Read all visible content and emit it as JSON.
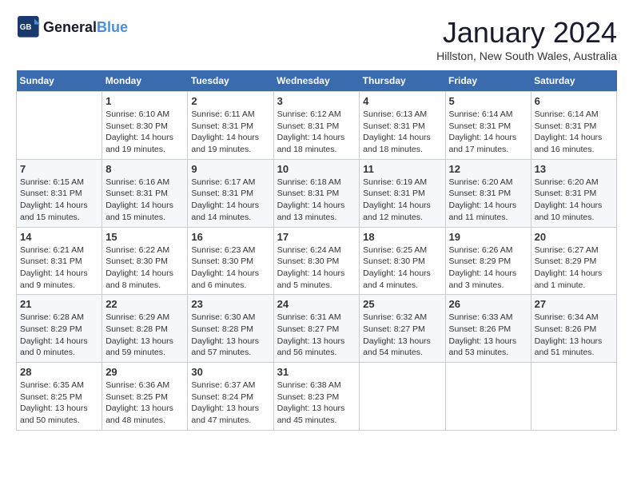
{
  "header": {
    "logo": "GeneralBlue",
    "title": "January 2024",
    "location": "Hillston, New South Wales, Australia"
  },
  "weekdays": [
    "Sunday",
    "Monday",
    "Tuesday",
    "Wednesday",
    "Thursday",
    "Friday",
    "Saturday"
  ],
  "weeks": [
    [
      {
        "day": "",
        "info": ""
      },
      {
        "day": "1",
        "info": "Sunrise: 6:10 AM\nSunset: 8:30 PM\nDaylight: 14 hours\nand 19 minutes."
      },
      {
        "day": "2",
        "info": "Sunrise: 6:11 AM\nSunset: 8:31 PM\nDaylight: 14 hours\nand 19 minutes."
      },
      {
        "day": "3",
        "info": "Sunrise: 6:12 AM\nSunset: 8:31 PM\nDaylight: 14 hours\nand 18 minutes."
      },
      {
        "day": "4",
        "info": "Sunrise: 6:13 AM\nSunset: 8:31 PM\nDaylight: 14 hours\nand 18 minutes."
      },
      {
        "day": "5",
        "info": "Sunrise: 6:14 AM\nSunset: 8:31 PM\nDaylight: 14 hours\nand 17 minutes."
      },
      {
        "day": "6",
        "info": "Sunrise: 6:14 AM\nSunset: 8:31 PM\nDaylight: 14 hours\nand 16 minutes."
      }
    ],
    [
      {
        "day": "7",
        "info": "Sunrise: 6:15 AM\nSunset: 8:31 PM\nDaylight: 14 hours\nand 15 minutes."
      },
      {
        "day": "8",
        "info": "Sunrise: 6:16 AM\nSunset: 8:31 PM\nDaylight: 14 hours\nand 15 minutes."
      },
      {
        "day": "9",
        "info": "Sunrise: 6:17 AM\nSunset: 8:31 PM\nDaylight: 14 hours\nand 14 minutes."
      },
      {
        "day": "10",
        "info": "Sunrise: 6:18 AM\nSunset: 8:31 PM\nDaylight: 14 hours\nand 13 minutes."
      },
      {
        "day": "11",
        "info": "Sunrise: 6:19 AM\nSunset: 8:31 PM\nDaylight: 14 hours\nand 12 minutes."
      },
      {
        "day": "12",
        "info": "Sunrise: 6:20 AM\nSunset: 8:31 PM\nDaylight: 14 hours\nand 11 minutes."
      },
      {
        "day": "13",
        "info": "Sunrise: 6:20 AM\nSunset: 8:31 PM\nDaylight: 14 hours\nand 10 minutes."
      }
    ],
    [
      {
        "day": "14",
        "info": "Sunrise: 6:21 AM\nSunset: 8:31 PM\nDaylight: 14 hours\nand 9 minutes."
      },
      {
        "day": "15",
        "info": "Sunrise: 6:22 AM\nSunset: 8:30 PM\nDaylight: 14 hours\nand 8 minutes."
      },
      {
        "day": "16",
        "info": "Sunrise: 6:23 AM\nSunset: 8:30 PM\nDaylight: 14 hours\nand 6 minutes."
      },
      {
        "day": "17",
        "info": "Sunrise: 6:24 AM\nSunset: 8:30 PM\nDaylight: 14 hours\nand 5 minutes."
      },
      {
        "day": "18",
        "info": "Sunrise: 6:25 AM\nSunset: 8:30 PM\nDaylight: 14 hours\nand 4 minutes."
      },
      {
        "day": "19",
        "info": "Sunrise: 6:26 AM\nSunset: 8:29 PM\nDaylight: 14 hours\nand 3 minutes."
      },
      {
        "day": "20",
        "info": "Sunrise: 6:27 AM\nSunset: 8:29 PM\nDaylight: 14 hours\nand 1 minute."
      }
    ],
    [
      {
        "day": "21",
        "info": "Sunrise: 6:28 AM\nSunset: 8:29 PM\nDaylight: 14 hours\nand 0 minutes."
      },
      {
        "day": "22",
        "info": "Sunrise: 6:29 AM\nSunset: 8:28 PM\nDaylight: 13 hours\nand 59 minutes."
      },
      {
        "day": "23",
        "info": "Sunrise: 6:30 AM\nSunset: 8:28 PM\nDaylight: 13 hours\nand 57 minutes."
      },
      {
        "day": "24",
        "info": "Sunrise: 6:31 AM\nSunset: 8:27 PM\nDaylight: 13 hours\nand 56 minutes."
      },
      {
        "day": "25",
        "info": "Sunrise: 6:32 AM\nSunset: 8:27 PM\nDaylight: 13 hours\nand 54 minutes."
      },
      {
        "day": "26",
        "info": "Sunrise: 6:33 AM\nSunset: 8:26 PM\nDaylight: 13 hours\nand 53 minutes."
      },
      {
        "day": "27",
        "info": "Sunrise: 6:34 AM\nSunset: 8:26 PM\nDaylight: 13 hours\nand 51 minutes."
      }
    ],
    [
      {
        "day": "28",
        "info": "Sunrise: 6:35 AM\nSunset: 8:25 PM\nDaylight: 13 hours\nand 50 minutes."
      },
      {
        "day": "29",
        "info": "Sunrise: 6:36 AM\nSunset: 8:25 PM\nDaylight: 13 hours\nand 48 minutes."
      },
      {
        "day": "30",
        "info": "Sunrise: 6:37 AM\nSunset: 8:24 PM\nDaylight: 13 hours\nand 47 minutes."
      },
      {
        "day": "31",
        "info": "Sunrise: 6:38 AM\nSunset: 8:23 PM\nDaylight: 13 hours\nand 45 minutes."
      },
      {
        "day": "",
        "info": ""
      },
      {
        "day": "",
        "info": ""
      },
      {
        "day": "",
        "info": ""
      }
    ]
  ]
}
